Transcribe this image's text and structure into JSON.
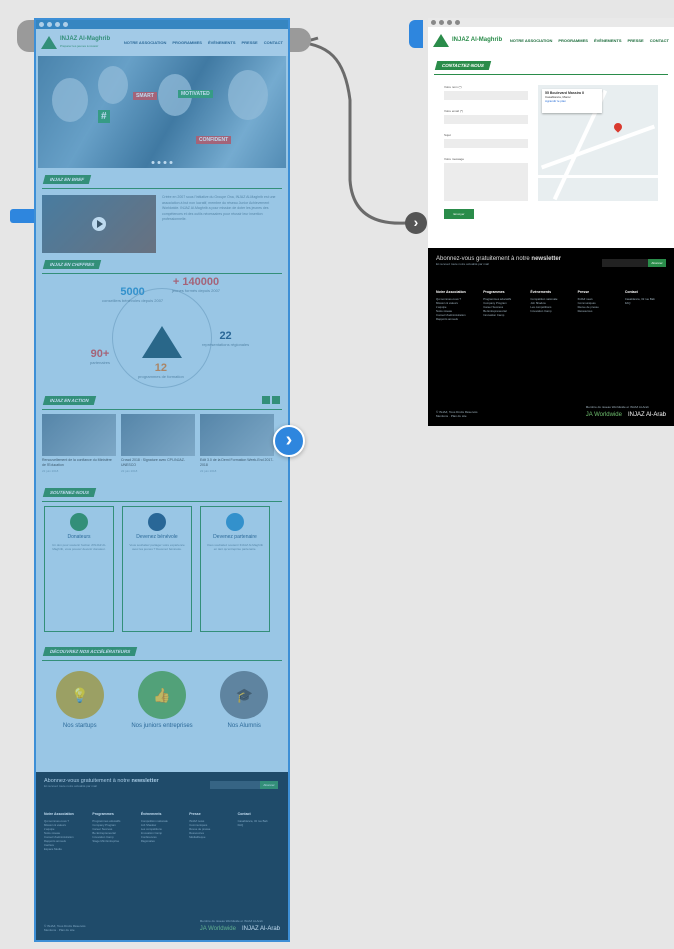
{
  "site": {
    "logo_name": "INJAZ Al-Maghrib",
    "logo_sub": "Préparer les jeunes à réussir",
    "nav": [
      "NOTRE ASSOCIATION",
      "PROGRAMMES",
      "ÉVÈNEMENTS",
      "PRESSE",
      "CONTACT"
    ]
  },
  "hero": {
    "signs": [
      "#",
      "CONFIDENT",
      "SMART",
      "MOTIVATED"
    ]
  },
  "about": {
    "label": "INJAZ EN BREF",
    "text": "Créée en 2007 sous l'initiative du Groupe Ona, INJAZ Al-Maghrib est une association à but non lucratif, membre du réseau Junior Achievement Worldwide. INJAZ Al-Maghrib a pour mission de doter les jeunes des compétences et des outils nécessaires pour réussir leur insertion professionnelle."
  },
  "figures": {
    "label": "INJAZ EN CHIFFRES",
    "items": [
      {
        "value": "5000",
        "caption": "conseillers bénévoles depuis 2007",
        "color": "#2a8fc9"
      },
      {
        "value": "+ 140000",
        "caption": "jeunes formés depuis 2007",
        "color": "#d84a4a"
      },
      {
        "value": "22",
        "caption": "représentations régionales",
        "color": "#1b4f78"
      },
      {
        "value": "90+",
        "caption": "partenaires",
        "color": "#d84a4a"
      },
      {
        "value": "12",
        "caption": "programmes de formation",
        "color": "#e07d2e"
      }
    ]
  },
  "news": {
    "label": "INJAZ EN ACTION",
    "items": [
      {
        "title": "Renouvellement de la confiance du Ministère de l'Education",
        "date": "22 juin 2018"
      },
      {
        "title": "Crowd 2018 : Signature avec CPI-INJAZ-UNESCO",
        "date": "22 juin 2018"
      },
      {
        "title": "Edit 3.0 de la Demi Formation Week-End 2017-2018",
        "date": "22 juin 2018"
      }
    ]
  },
  "support": {
    "label": "SOUTENEZ-NOUS",
    "items": [
      {
        "title": "Donateurs",
        "body": "Un don pour soutenir l'action d'INJAZ Al-Maghrib, vous pouvez devenir donateur.",
        "color": "#2a8c4a"
      },
      {
        "title": "Devenez bénévole",
        "body": "Vous souhaitez partager votre expérience avec les jeunes ? Devenez bénévole.",
        "color": "#1b4f78"
      },
      {
        "title": "Devenez partenaire",
        "body": "Vous souhaitez soutenir INJAZ Al-Maghrib en tant qu'entreprise partenaire.",
        "color": "#2a8fc9"
      }
    ]
  },
  "accelerators": {
    "label": "DÉCOUVREZ NOS ACCÉLÉRATEURS",
    "items": [
      {
        "label": "Nos startups",
        "color": "#c9a72a",
        "icon": "lightbulb-icon"
      },
      {
        "label": "Nos juniors entreprises",
        "color": "#5aa84a",
        "icon": "thumbs-up-icon"
      },
      {
        "label": "Nos Alumnis",
        "color": "#6d7c86",
        "icon": "graduation-cap-icon"
      }
    ]
  },
  "footer": {
    "newsletter_prefix": "Abonnez-vous gratuitement à notre",
    "newsletter_word": "newsletter",
    "newsletter_sub": "Et recevez toute notre actualité par mail",
    "subscribe_label": "Abonner",
    "columns": [
      {
        "title": "Notre Association",
        "links": [
          "Qui sommes-nous ?",
          "Mission & valeurs",
          "L'équipe",
          "Notre réseau",
          "Conseil d'administration",
          "Rapports annuels",
          "Carrière",
          "Espace Media"
        ]
      },
      {
        "title": "Programmes",
        "links": [
          "Programmes éducatifs",
          "Company Program",
          "Career Success",
          "Be Entrepreneurial",
          "Innovation Camp",
          "Stage Mini Entreprise"
        ]
      },
      {
        "title": "Évènements",
        "links": [
          "Compétition nationale",
          "Job Shadow",
          "Les compétitions",
          "Innovation Camp",
          "Conférences",
          "Régionales"
        ]
      },
      {
        "title": "Presse",
        "links": [
          "INJAZ news",
          "Communiqués",
          "Revue de presse",
          "Ressources",
          "Médiathèque"
        ]
      },
      {
        "title": "Contact",
        "links": [
          "Casablanca, 32 rue Bab",
          "FAQ"
        ]
      }
    ],
    "copyright": "© INJAZ, Tous Droits Réservés",
    "legal": "Mentions · Plan du site",
    "member": "Membre du réseau Worldwide et INJAZ Al-Arab",
    "ja_logo": "JA Worldwide",
    "arab_logo": "INJAZ Al-Arab"
  },
  "contact": {
    "label": "CONTACTEZ-NOUS",
    "fields": [
      "Votre nom (*)",
      "Votre email (*)",
      "Sujet",
      "Votre message"
    ],
    "send_label": "Envoyer",
    "map_card_title": "55 Boulevard Massira II",
    "map_card_sub": "Casablanca, Maroc",
    "map_card_link": "Agrandir le plan"
  }
}
